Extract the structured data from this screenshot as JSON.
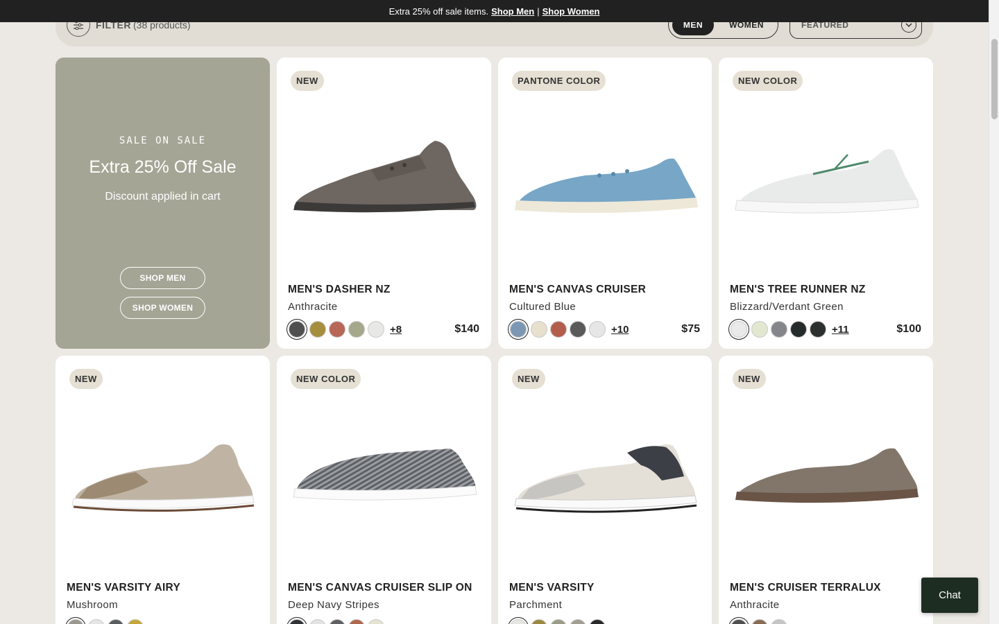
{
  "promo_bar": {
    "text": "Extra 25% off sale items.",
    "shop_men": "Shop Men",
    "separator": "|",
    "shop_women": "Shop Women"
  },
  "filter_bar": {
    "filter_label": "FILTER",
    "product_count": "(38 products)",
    "gender_men": "MEN",
    "gender_women": "WOMEN",
    "sort_label": "FEATURED",
    "selected_gender": "MEN"
  },
  "promo_card": {
    "kicker": "SALE ON SALE",
    "title": "Extra 25% Off Sale",
    "subtitle": "Discount applied in cart",
    "shop_men": "SHOP MEN",
    "shop_women": "SHOP WOMEN",
    "bg_color": "#a4a595"
  },
  "products": [
    {
      "badge": "NEW",
      "name": "MEN'S DASHER NZ",
      "color": "Anthracite",
      "more": "+8",
      "price": "$140",
      "swatches": [
        "#4f4f4f",
        "#a58f3e",
        "#b86656",
        "#a5a88a",
        "#e8e8e6"
      ]
    },
    {
      "badge": "PANTONE COLOR",
      "name": "MEN'S CANVAS CRUISER",
      "color": "Cultured Blue",
      "more": "+10",
      "price": "$75",
      "swatches": [
        "#7b97b3",
        "#e6e0cc",
        "#b35e4c",
        "#5a5a5a",
        "#e6e6e6"
      ]
    },
    {
      "badge": "NEW COLOR",
      "name": "MEN'S TREE RUNNER NZ",
      "color": "Blizzard/Verdant Green",
      "more": "+11",
      "price": "$100",
      "swatches": [
        "#eaeaea",
        "#e2e8d0",
        "#85868b",
        "#252a2a",
        "#2c3130"
      ]
    },
    {
      "badge": "NEW",
      "name": "MEN'S VARSITY AIRY",
      "color": "Mushroom",
      "more": "",
      "price": "",
      "swatches": [
        "#9b988d",
        "#e5e5e5",
        "#5a5d5f",
        "#c4a73b"
      ]
    },
    {
      "badge": "NEW COLOR",
      "name": "MEN'S CANVAS CRUISER SLIP ON",
      "color": "Deep Navy Stripes",
      "more": "",
      "price": "",
      "swatches": [
        "#2f3336",
        "#e3e3e3",
        "#5e6062",
        "#b0674f",
        "#e7e3d2"
      ]
    },
    {
      "badge": "NEW",
      "name": "MEN'S VARSITY",
      "color": "Parchment",
      "more": "",
      "price": "",
      "swatches": [
        "#e8e6e0",
        "#9c8840",
        "#9a9c88",
        "#a39e92",
        "#2a2a2a"
      ]
    },
    {
      "badge": "NEW",
      "name": "MEN'S CRUISER TERRALUX",
      "color": "Anthracite",
      "more": "",
      "price": "",
      "swatches": [
        "#4f5050",
        "#8a6c56",
        "#c5c5c5"
      ]
    }
  ],
  "chat": {
    "label": "Chat"
  }
}
